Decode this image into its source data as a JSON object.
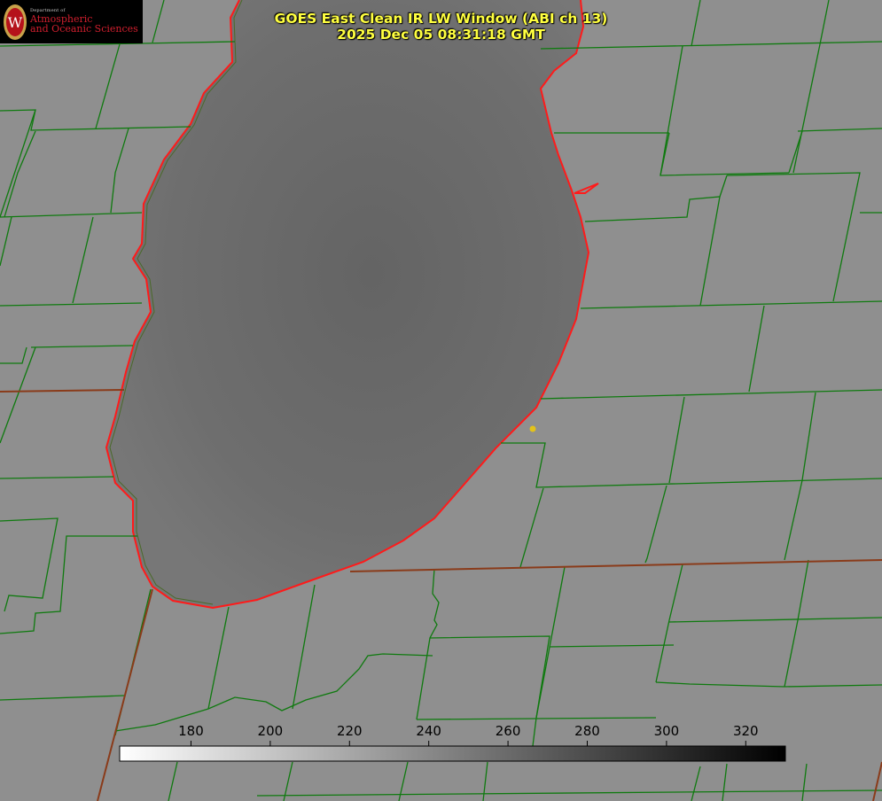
{
  "title": {
    "line1": "GOES East Clean IR LW Window (ABI ch 13)",
    "line2": "2025 Dec 05 08:31:18 GMT"
  },
  "logo": {
    "crest_letter": "W",
    "dept": "Department of",
    "line1": "Atmospheric",
    "line2": "and Oceanic Sciences"
  },
  "colors": {
    "land": "#8f8f8f",
    "lake": "#6c6c6c",
    "county_lines": "#0f7a0f",
    "shoreline": "#ff1a1a",
    "state_lines": "#8a3b1a",
    "title_text": "#ffff40",
    "marker": "#e3c21a"
  },
  "colorbar": {
    "ticks": [
      "180",
      "200",
      "220",
      "240",
      "260",
      "280",
      "300",
      "320"
    ],
    "range": [
      162,
      330
    ],
    "colors": [
      "#ffffff",
      "#000000"
    ]
  },
  "icons": [
    "wisconsin-crest-icon",
    "location-dot-icon"
  ]
}
